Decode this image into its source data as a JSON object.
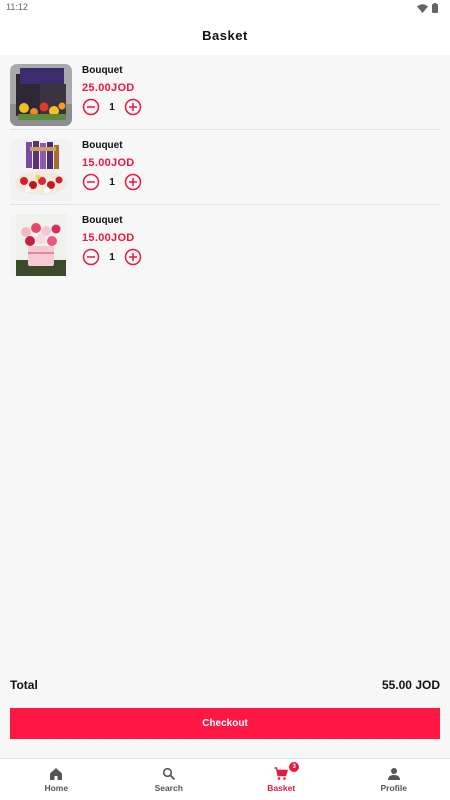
{
  "status_bar": {
    "time": "11:12",
    "icons": [
      "wifi-icon",
      "battery-icon"
    ]
  },
  "header": {
    "title": "Basket"
  },
  "colors": {
    "accent": "#e8183e",
    "checkout": "#ff1744",
    "background": "#f7f7f7"
  },
  "basket": {
    "items": [
      {
        "name": "Bouquet",
        "price": "25.00JOD",
        "quantity": "1",
        "image": "bouquet-photo-dark-box"
      },
      {
        "name": "Bouquet",
        "price": "15.00JOD",
        "quantity": "1",
        "image": "bouquet-photo-chocolates-roses"
      },
      {
        "name": "Bouquet",
        "price": "15.00JOD",
        "quantity": "1",
        "image": "bouquet-photo-pink-box"
      }
    ]
  },
  "summary": {
    "total_label": "Total",
    "total_value": "55.00 JOD"
  },
  "checkout": {
    "label": "Checkout"
  },
  "bottom_nav": {
    "items": [
      {
        "label": "Home",
        "icon": "home-icon"
      },
      {
        "label": "Search",
        "icon": "search-icon"
      },
      {
        "label": "Basket",
        "icon": "cart-icon",
        "badge": "3",
        "active": true
      },
      {
        "label": "Profile",
        "icon": "person-icon"
      }
    ]
  }
}
